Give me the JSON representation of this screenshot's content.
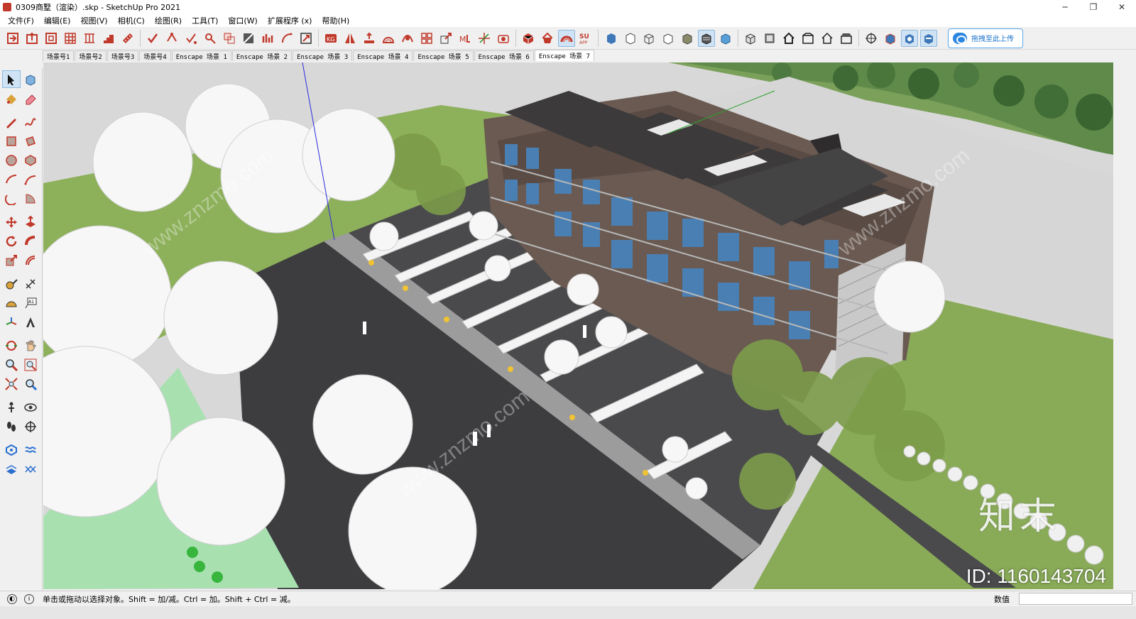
{
  "window": {
    "title": "0309商墅（渲染）.skp - SketchUp Pro 2021",
    "controls": {
      "minimize": "─",
      "restore": "❐",
      "close": "✕"
    }
  },
  "menu": {
    "items": [
      "文件(F)",
      "编辑(E)",
      "视图(V)",
      "相机(C)",
      "绘图(R)",
      "工具(T)",
      "窗口(W)",
      "扩展程序 (x)",
      "帮助(H)"
    ]
  },
  "toolbar": {
    "upload_label": "拖拽至此上传",
    "su_app_label": "SU\nAPP"
  },
  "scenes": {
    "tabs": [
      "场景号1",
      "场景号2",
      "场景号3",
      "场景号4",
      "Enscape 场景 1",
      "Enscape 场景 2",
      "Enscape 场景 3",
      "Enscape 场景 4",
      "Enscape 场景 5",
      "Enscape 场景 6",
      "Enscape 场景 7"
    ],
    "active_index": 10
  },
  "viewport": {
    "watermark_logo": "知末",
    "watermark_id": "ID: 1160143704",
    "watermark_site": "www.znzmo.com"
  },
  "status": {
    "hint": "单击或拖动以选择对象。Shift = 加/减。Ctrl = 加。Shift + Ctrl = 减。",
    "measure_label": "数值",
    "measure_value": ""
  },
  "colors": {
    "accent": "#c0392b",
    "selection_blue": "#cfe3f5",
    "grass": "#8fb15a",
    "road": "#3e3e40",
    "roof": "#3d3a3b",
    "facade": "#6a5a52"
  }
}
